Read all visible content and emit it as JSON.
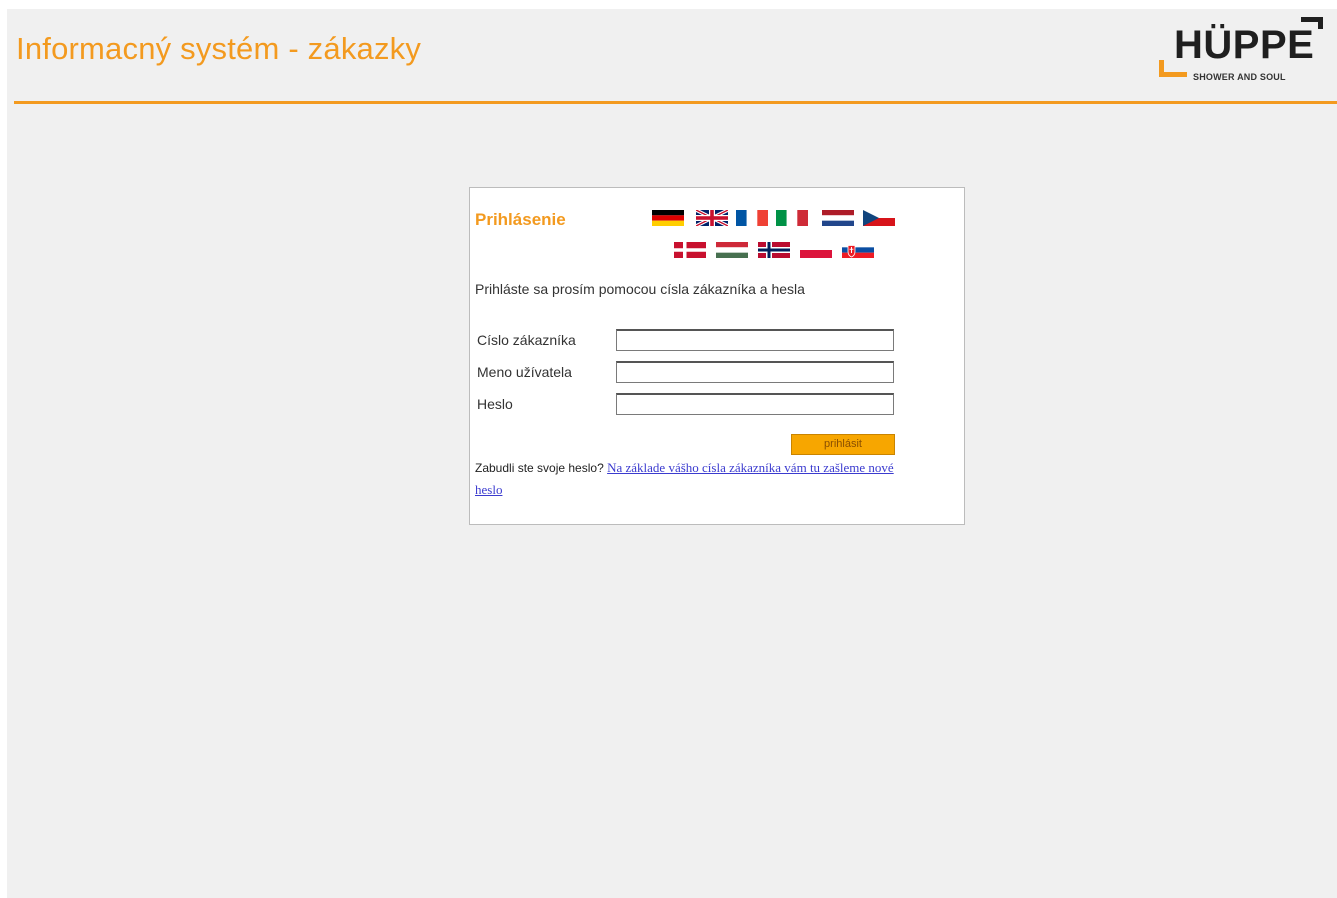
{
  "header": {
    "title": "Informacný systém - zákazky",
    "logo_word": "HÜPPE",
    "logo_tagline": "SHOWER AND SOUL"
  },
  "login": {
    "heading": "Prihlásenie",
    "instruction": "Prihláste sa prosím pomocou císla zákazníka a hesla",
    "fields": [
      {
        "label": "Císlo zákazníka",
        "value": "",
        "placeholder": ""
      },
      {
        "label": "Meno užívatela",
        "value": "",
        "placeholder": ""
      },
      {
        "label": "Heslo",
        "value": "",
        "placeholder": ""
      }
    ],
    "submit_label": "prihlásit",
    "forgot_text": "Zabudli ste svoje heslo?",
    "forgot_link": "Na základe vášho císla zákazníka vám tu zašleme nové heslo"
  },
  "languages": {
    "row1": [
      "german-flag",
      "uk-flag",
      "french-flag",
      "italian-flag",
      "dutch-flag",
      "czech-flag"
    ],
    "row2": [
      "danish-flag",
      "hungarian-flag",
      "norwegian-flag",
      "polish-flag",
      "slovak-flag"
    ]
  },
  "colors": {
    "accent": "#f39a1f",
    "button": "#f7a600",
    "link": "#3b3bcf",
    "background": "#f0f0f0"
  }
}
